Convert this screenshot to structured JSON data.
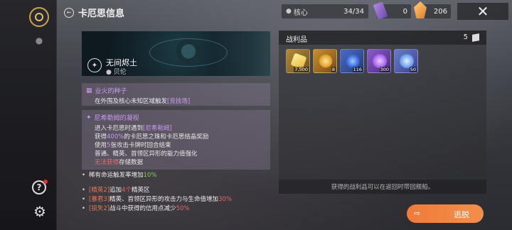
{
  "header": {
    "title": "卡厄思信息"
  },
  "resources": {
    "core_label": "核心",
    "core_value": "34/34",
    "ticket_value": "0",
    "gem_value": "206"
  },
  "banner": {
    "name": "无间烬土",
    "location": "贝伦"
  },
  "card1": {
    "title": "业火的种子",
    "line_prefix": "在外围及核心未知区域触发",
    "line_highlight": "[竞技场]"
  },
  "card2": {
    "title": "尼希勒姆的凝视",
    "l1_prefix": "进入卡厄思时遇到",
    "l1_highlight": "[尼希勒姆]",
    "l2_prefix": "获得",
    "l2_highlight": "400%",
    "l2_suffix": "的卡厄思之珠和卡厄思结晶奖励",
    "l3_prefix": "使用",
    "l3_highlight": "5",
    "l3_suffix": "张攻击卡牌时回合结束",
    "l4": "普通、精英、首领区异形的能力值强化",
    "l5_highlight": "无法获得",
    "l5_suffix": "存储数据"
  },
  "notes": {
    "n1_prefix": "稀有命运触发率增加",
    "n1_value": "10%",
    "n2_tag": "[精英2]",
    "n2_prefix": "追加",
    "n2_value": "4个",
    "n2_suffix": "精英区",
    "n3_tag": "[暴君3]",
    "n3_prefix": "精英、首领区异形的攻击力与生命值增加",
    "n3_value": "30%",
    "n4_tag": "[损失2]",
    "n4_prefix": "战斗中获得的信用点减少",
    "n4_value": "50%"
  },
  "loot": {
    "title": "战利品",
    "count": "5",
    "footer": "获得的战利品可以在返回时带回舰船。",
    "items": [
      {
        "icon": "yellow-crystal-icon",
        "qty": "7,500"
      },
      {
        "icon": "gold-wings-icon",
        "qty": "8"
      },
      {
        "icon": "blue-orb-icon",
        "qty": "116"
      },
      {
        "icon": "purple-orb-icon",
        "qty": "300"
      },
      {
        "icon": "light-blue-orb-icon",
        "qty": "50"
      }
    ]
  },
  "escape": {
    "label": "逃脱"
  },
  "colors": {
    "accent": "#f07a3a",
    "highlight": "#c89af0",
    "positive": "#7ed05a",
    "negative": "#e06a6a"
  }
}
